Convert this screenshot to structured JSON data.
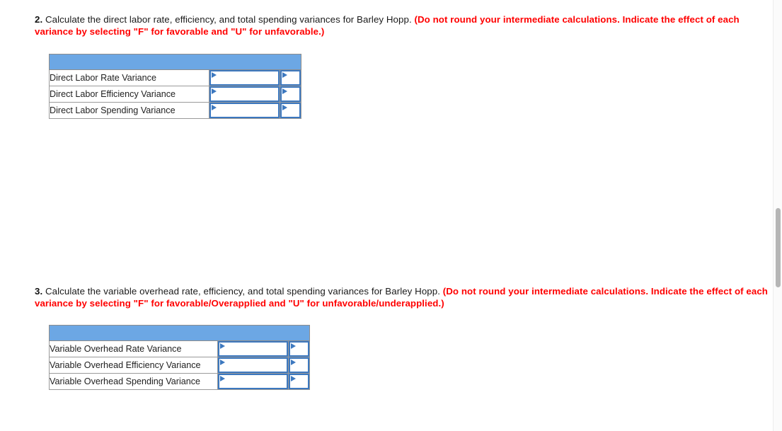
{
  "questions": [
    {
      "number": "2.",
      "prompt": "Calculate the direct labor rate, efficiency, and total spending variances for Barley Hopp.",
      "emphasis": "(Do not round your intermediate calculations. Indicate the effect of each variance by selecting \"F\" for favorable and \"U\" for unfavorable.)"
    },
    {
      "number": "3.",
      "prompt": "Calculate the variable overhead rate, efficiency, and total spending variances for Barley Hopp.",
      "emphasis": "(Do not round your intermediate calculations. Indicate the effect of each variance by selecting \"F\" for favorable/Overapplied and \"U\" for unfavorable/underapplied.)"
    }
  ],
  "tables": [
    {
      "header_label": "",
      "rows": [
        {
          "label": "Direct Labor Rate Variance",
          "amount": "",
          "effect": ""
        },
        {
          "label": "Direct Labor Efficiency Variance",
          "amount": "",
          "effect": ""
        },
        {
          "label": "Direct Labor Spending Variance",
          "amount": "",
          "effect": ""
        }
      ]
    },
    {
      "header_label": "",
      "rows": [
        {
          "label": "Variable Overhead Rate Variance",
          "amount": "",
          "effect": ""
        },
        {
          "label": "Variable Overhead Efficiency Variance",
          "amount": "",
          "effect": ""
        },
        {
          "label": "Variable Overhead Spending Variance",
          "amount": "",
          "effect": ""
        }
      ]
    }
  ],
  "colors": {
    "header_blue": "#6ca7e4",
    "input_border_blue": "#3c78bf",
    "emphasis_red": "#ff0000",
    "cell_border_gray": "#9a9a9a",
    "scrollbar_thumb": "#b6b6b6"
  }
}
